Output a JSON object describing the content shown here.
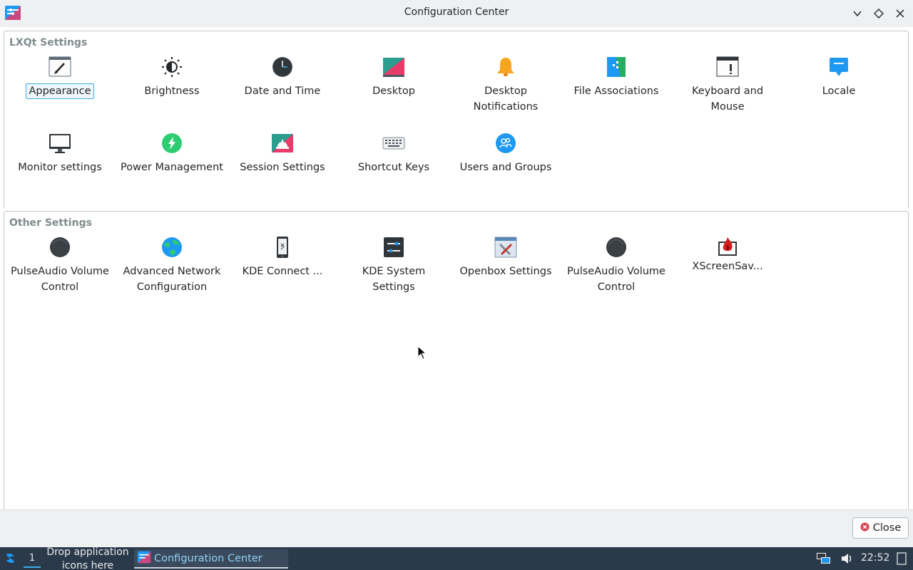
{
  "window": {
    "title": "Configuration Center",
    "app_icon": "configuration-center-icon",
    "controls": [
      "minimize",
      "maximize",
      "close"
    ]
  },
  "groups": [
    {
      "title": "LXQt Settings",
      "items": [
        {
          "label": "Appearance",
          "icon": "appearance-icon",
          "selected": true
        },
        {
          "label": "Brightness",
          "icon": "brightness-icon"
        },
        {
          "label": "Date and Time",
          "icon": "clock-icon"
        },
        {
          "label": "Desktop",
          "icon": "desktop-icon"
        },
        {
          "label": "Desktop Notifications",
          "icon": "bell-icon"
        },
        {
          "label": "File Associations",
          "icon": "file-associations-icon"
        },
        {
          "label": "Keyboard and Mouse",
          "icon": "keyboard-mouse-icon"
        },
        {
          "label": "Locale",
          "icon": "locale-icon"
        },
        {
          "label": "Monitor settings",
          "icon": "monitor-icon"
        },
        {
          "label": "Power Management",
          "icon": "power-icon"
        },
        {
          "label": "Session Settings",
          "icon": "session-icon"
        },
        {
          "label": "Shortcut Keys",
          "icon": "keyboard-icon"
        },
        {
          "label": "Users and Groups",
          "icon": "users-icon"
        }
      ]
    },
    {
      "title": "Other Settings",
      "items": [
        {
          "label": "PulseAudio Volume Control",
          "icon": "pulseaudio-icon"
        },
        {
          "label": "Advanced Network Configuration",
          "icon": "globe-icon"
        },
        {
          "label": "KDE Connect ...",
          "icon": "phone-icon"
        },
        {
          "label": "KDE System Settings",
          "icon": "system-settings-icon"
        },
        {
          "label": "Openbox Settings",
          "icon": "openbox-icon"
        },
        {
          "label": "PulseAudio Volume Control",
          "icon": "pulseaudio-icon"
        },
        {
          "label": "XScreenSav...",
          "icon": "xscreensaver-icon"
        }
      ]
    }
  ],
  "footer": {
    "close_label": "Close"
  },
  "taskbar": {
    "desktop_number": "1",
    "drop_hint": "Drop application icons here",
    "task_label": "Configuration Center",
    "clock": "22:52"
  },
  "colors": {
    "accent": "#3daee9",
    "taskbar_bg": "#2b3a4a",
    "group_title": "#7f8c8d"
  }
}
